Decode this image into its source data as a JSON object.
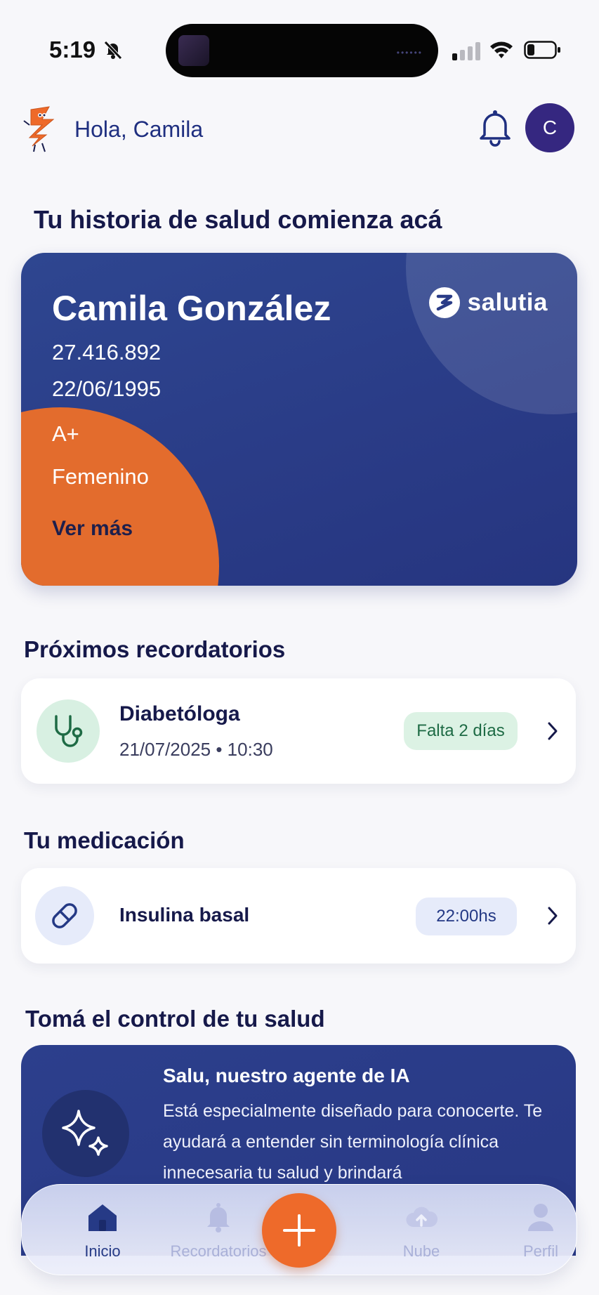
{
  "status_bar": {
    "time": "5:19"
  },
  "header": {
    "greeting": "Hola, Camila",
    "avatar_initial": "C"
  },
  "health_section": {
    "title": "Tu historia de salud comienza acá"
  },
  "health_card": {
    "name": "Camila González",
    "document": "27.416.892",
    "birthdate": "22/06/1995",
    "blood_type": "A+",
    "sex": "Femenino",
    "more_label": "Ver más",
    "brand": "salutia"
  },
  "reminders": {
    "title": "Próximos recordatorios",
    "items": [
      {
        "title": "Diabetóloga",
        "datetime": "21/07/2025 • 10:30",
        "badge": "Falta 2 días"
      }
    ]
  },
  "medication": {
    "title": "Tu medicación",
    "items": [
      {
        "title": "Insulina basal",
        "time": "22:00hs"
      }
    ]
  },
  "control": {
    "title": "Tomá el control de tu salud",
    "ai_title": "Salu, nuestro agente de IA",
    "ai_description": "Está especialmente diseñado para conocerte. Te ayudará a entender sin terminología clínica innecesaria tu salud y brindará"
  },
  "nav": {
    "items": [
      {
        "label": "Inicio"
      },
      {
        "label": "Recordatorios"
      },
      {
        "label": "Nube"
      },
      {
        "label": "Perfil"
      }
    ]
  },
  "colors": {
    "brand_blue": "#2a3c87",
    "accent_orange": "#e36c2d",
    "badge_green_bg": "#dcf2e4",
    "badge_blue_bg": "#e6ebfa"
  }
}
